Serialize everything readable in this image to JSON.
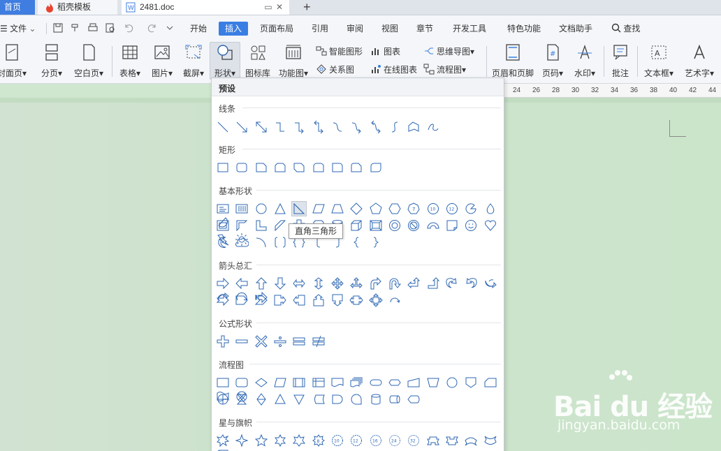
{
  "tabs": {
    "home": "首页",
    "wps_template": "稻壳模板",
    "document": "2481.doc",
    "new_tab": "+"
  },
  "menu": {
    "file": "文件",
    "items": [
      "开始",
      "插入",
      "页面布局",
      "引用",
      "审阅",
      "视图",
      "章节",
      "开发工具",
      "特色功能",
      "文档助手"
    ],
    "active": "插入",
    "search": "查找"
  },
  "ribbon": {
    "cover": "封面页",
    "page_break": "分页",
    "blank_page": "空白页",
    "table": "表格",
    "picture": "图片",
    "screenshot": "截屏",
    "shape": "形状",
    "icon_library": "图标库",
    "function_chart": "功能图",
    "smart_graphic": "智能图形",
    "chart": "图表",
    "mind_map": "思维导图",
    "relation_chart": "关系图",
    "online_chart": "在线图表",
    "flowchart": "流程图",
    "header_footer": "页眉和页脚",
    "page_number": "页码",
    "watermark": "水印",
    "comment": "批注",
    "textbox": "文本框",
    "wordart": "艺术字"
  },
  "ruler": [
    "24",
    "26",
    "28",
    "30",
    "32",
    "34",
    "36",
    "38",
    "40",
    "42",
    "44"
  ],
  "shapes_panel": {
    "header": "预设",
    "sections": [
      "线条",
      "矩形",
      "基本形状",
      "箭头总汇",
      "公式形状",
      "流程图",
      "星与旗帜"
    ],
    "tooltip": "直角三角形"
  },
  "watermark": {
    "brand": "Bai du 经验",
    "url": "jingyan.baidu.com"
  },
  "colors": {
    "accent": "#3a7ee4",
    "shape_stroke": "#2e67b3",
    "doc_bg": "#cbe5cb"
  }
}
